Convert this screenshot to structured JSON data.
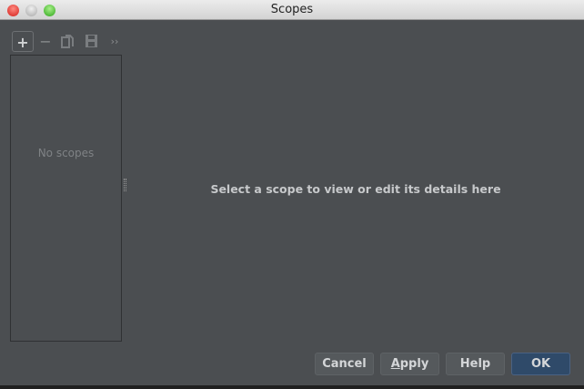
{
  "window": {
    "title": "Scopes"
  },
  "toolbar": {
    "add": "+",
    "remove": "−",
    "more": "››"
  },
  "list": {
    "empty_text": "No scopes"
  },
  "detail": {
    "hint": "Select a scope to view or edit its details here"
  },
  "buttons": {
    "cancel": "Cancel",
    "apply_mnemonic": "A",
    "apply_rest": "pply",
    "help": "Help",
    "ok": "OK"
  }
}
